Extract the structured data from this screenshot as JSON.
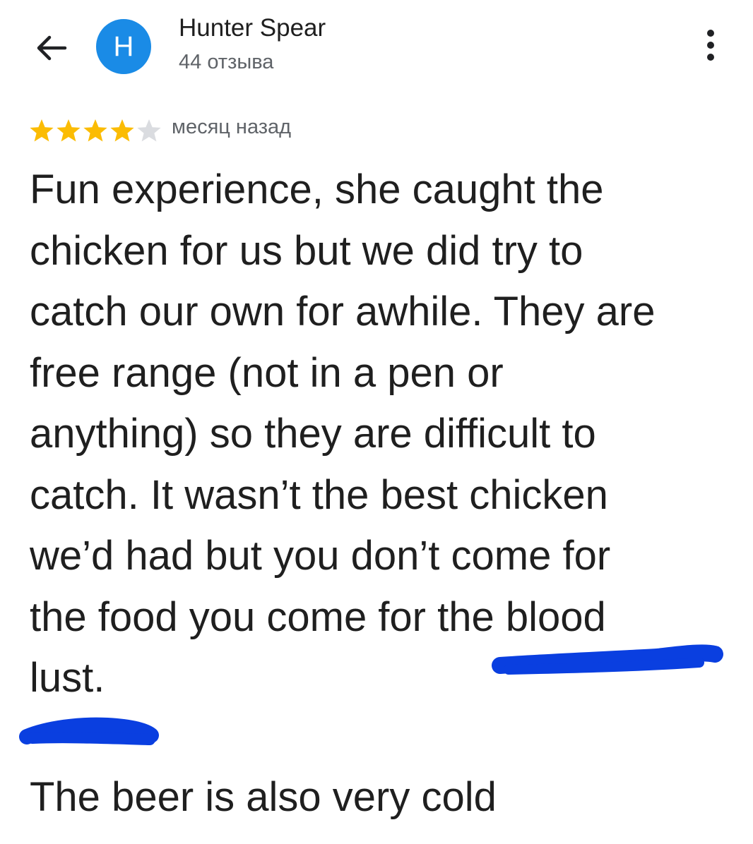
{
  "header": {
    "back_icon": "arrow-back-icon",
    "avatar_letter": "H",
    "avatar_color": "#1a8be6",
    "author_name": "Hunter Spear",
    "review_count": "44 отзыва",
    "more_icon": "more-vertical-icon"
  },
  "review": {
    "rating": 4,
    "rating_max": 5,
    "star_filled_color": "#fbbc04",
    "star_empty_color": "#dadce0",
    "date": "месяц назад",
    "text_lines": [
      "Fun experience, she caught the",
      "chicken for us but we did try to",
      "catch our own for awhile. They are",
      "free range (not in a pen or",
      "anything) so they are difficult to",
      "catch. It wasn’t the best chicken",
      "we’d had but you don’t come for",
      "the food you come for the blood",
      "lust."
    ],
    "extra_text": "The beer is also very cold"
  },
  "annotations": {
    "marker_color": "#0a3fe0"
  }
}
